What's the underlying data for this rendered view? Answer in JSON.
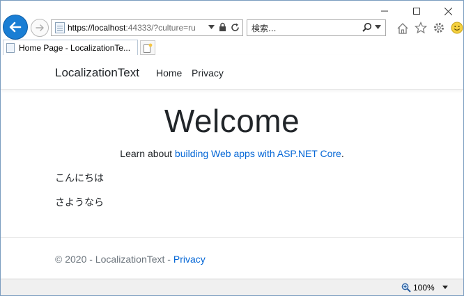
{
  "browser": {
    "address": {
      "host": "https://localhost",
      "rest": ":44333/?culture=ru"
    },
    "search": {
      "placeholder": "検索..."
    },
    "tab": {
      "title": "Home Page - LocalizationTe..."
    },
    "zoom_level": "100%"
  },
  "site": {
    "brand": "LocalizationText",
    "nav": {
      "home": "Home",
      "privacy": "Privacy"
    },
    "heading": "Welcome",
    "learn": {
      "prefix": "Learn about ",
      "link": "building Web apps with ASP.NET Core",
      "suffix": "."
    },
    "greetings": [
      "こんにちは",
      "さようなら"
    ],
    "footer": {
      "text": "© 2020 - LocalizationText - ",
      "link": "Privacy"
    }
  },
  "colors": {
    "accent": "#1a7ed4",
    "link": "#0366d6"
  }
}
